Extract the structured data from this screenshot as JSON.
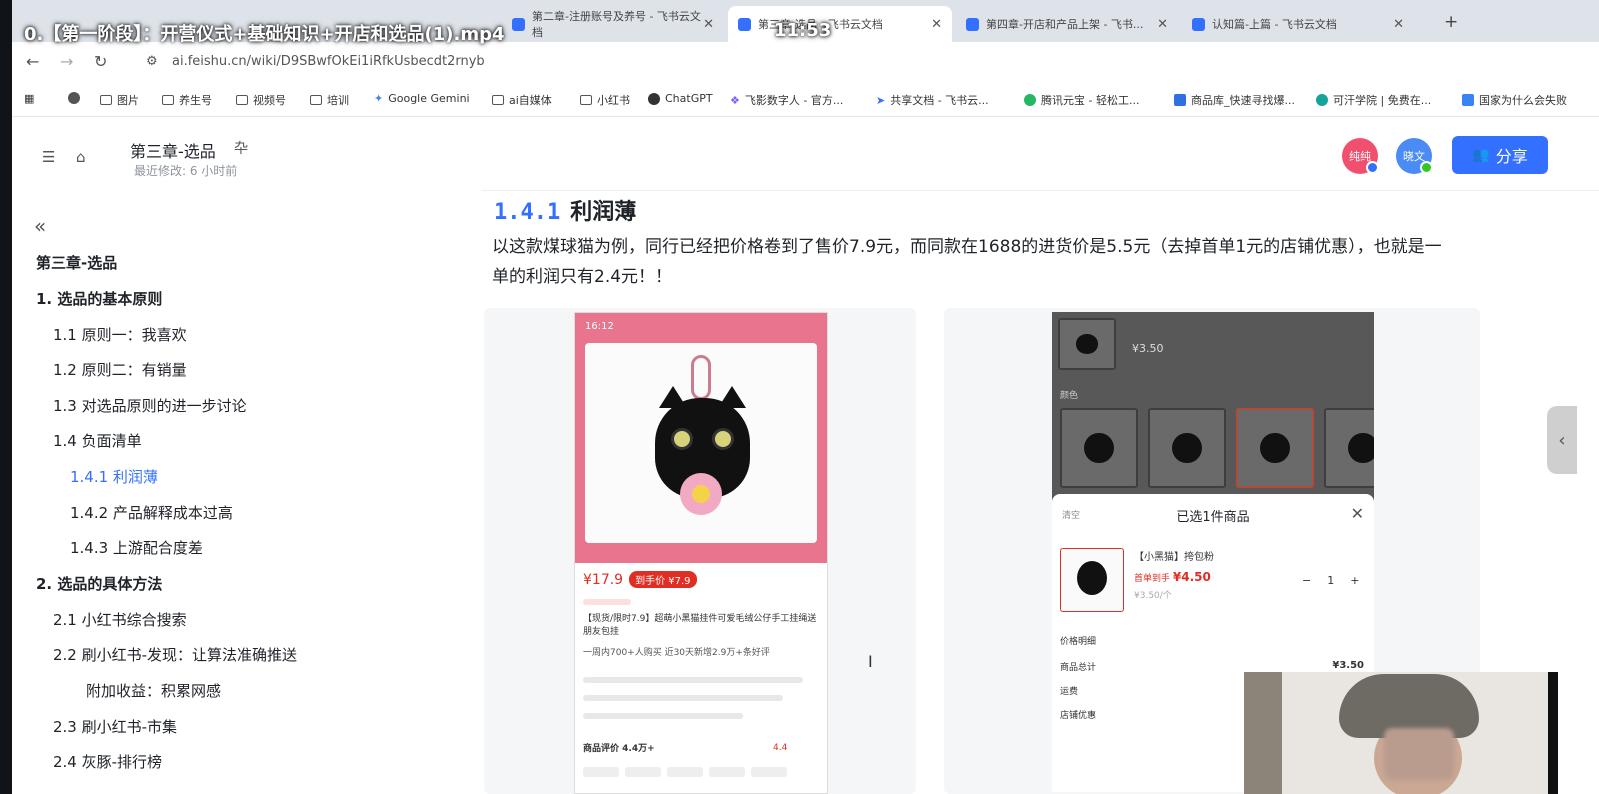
{
  "video": {
    "title": "0.【第一阶段】：开营仪式+基础知识+开店和选品(1).mp4",
    "time": "11:53"
  },
  "tabs": [
    {
      "label": "第二章-注册账号及养号 - 飞书云文档"
    },
    {
      "label": "第三章-选品 - 飞书云文档"
    },
    {
      "label": "第四章-开店和产品上架 - 飞书..."
    },
    {
      "label": "认知篇-上篇 - 飞书云文档"
    }
  ],
  "browser": {
    "url": "ai.feishu.cn/wiki/D9SBwfOkEi1iRfkUsbecdt2rnyb"
  },
  "bookmarks": [
    {
      "label": "图片"
    },
    {
      "label": "养生号"
    },
    {
      "label": "视频号"
    },
    {
      "label": "培训"
    },
    {
      "label": "Google Gemini"
    },
    {
      "label": "ai自媒体"
    },
    {
      "label": "小红书"
    },
    {
      "label": "ChatGPT"
    },
    {
      "label": "飞影数字人 - 官方..."
    },
    {
      "label": "共享文档 - 飞书云..."
    },
    {
      "label": "腾讯元宝 - 轻松工..."
    },
    {
      "label": "商品库_快速寻找爆..."
    },
    {
      "label": "可汗学院 | 免费在..."
    },
    {
      "label": "国家为什么会失败"
    }
  ],
  "doc": {
    "title": "第三章-选品",
    "modified": "最近修改: 6 小时前",
    "avatar1": "纯纯",
    "avatar2": "晓文",
    "share_label": "分享"
  },
  "toc": [
    {
      "label": "第三章-选品"
    },
    {
      "label": "1. 选品的基本原则"
    },
    {
      "label": "1.1 原则一：我喜欢"
    },
    {
      "label": "1.2 原则二：有销量"
    },
    {
      "label": "1.3 对选品原则的进一步讨论"
    },
    {
      "label": "1.4 负面清单"
    },
    {
      "label": "1.4.1 利润薄"
    },
    {
      "label": "1.4.2 产品解释成本过高"
    },
    {
      "label": "1.4.3 上游配合度差"
    },
    {
      "label": "2. 选品的具体方法"
    },
    {
      "label": "2.1 小红书综合搜索"
    },
    {
      "label": "2.2 刷小红书-发现：让算法准确推送"
    },
    {
      "label": "附加收益：积累网感"
    },
    {
      "label": "2.3 刷小红书-市集"
    },
    {
      "label": "2.4 灰豚-排行榜"
    }
  ],
  "content": {
    "heading_num": "1.4.1",
    "heading_text": "利润薄",
    "paragraph": "以这款煤球猫为例，同行已经把价格卷到了售价7.9元，而同款在1688的进货价是5.5元（去掉首单1元的店铺优惠），也就是一单的利润只有2.4元！！"
  },
  "screenshot1": {
    "time": "16:12",
    "price": "¥17.9",
    "tag": "到手价 ¥7.9",
    "title": "【现货/限时7.9】超萌小黑猫挂件可爱毛绒公仔手工挂绳送朋友包挂",
    "sales": "一周内700+人购买   近30天新增2.9万+条好评",
    "review_label": "商品评价 4.4万+",
    "review_score": "4.4"
  },
  "screenshot2": {
    "price": "¥3.50",
    "color_label": "颜色",
    "sheet_title": "已选1件商品",
    "clear_label": "清空",
    "item_name": "【小黑猫】挎包粉",
    "item_price_label": "首单到手",
    "item_price": "¥4.50",
    "item_orig": "¥3.50/个",
    "qty": "1",
    "detail_label": "价格明细",
    "total_label": "商品总计",
    "total_value": "¥3.50",
    "shipping_label": "运费",
    "discount_label": "店铺优惠"
  }
}
